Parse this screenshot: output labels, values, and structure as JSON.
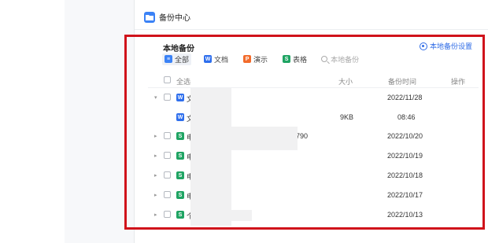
{
  "window": {
    "title": "备份中心"
  },
  "panel": {
    "title": "本地备份",
    "settings_label": "本地备份设置",
    "filters": [
      {
        "label": "全部",
        "icon": "list-icon",
        "active": true
      },
      {
        "label": "文档",
        "icon": "doc-icon",
        "glyph": "W"
      },
      {
        "label": "演示",
        "icon": "ppt-icon",
        "glyph": "P"
      },
      {
        "label": "表格",
        "icon": "xls-icon",
        "glyph": "S"
      }
    ],
    "search_placeholder": "本地备份"
  },
  "table": {
    "headers": {
      "select_all": "全选",
      "size": "大小",
      "time": "备份时间",
      "ops": "操作"
    },
    "rows": [
      {
        "expand": "▾",
        "initial": "文",
        "size": "",
        "date": "2022/11/28",
        "suffix": ""
      },
      {
        "expand": "",
        "initial": "文",
        "size": "9KB",
        "date": "08:46",
        "suffix": ""
      },
      {
        "expand": "▸",
        "initial": "电",
        "size": "",
        "date": "2022/10/20",
        "suffix": "790"
      },
      {
        "expand": "▸",
        "initial": "电",
        "size": "",
        "date": "2022/10/19",
        "suffix": ""
      },
      {
        "expand": "▸",
        "initial": "电",
        "size": "",
        "date": "2022/10/18",
        "suffix": ""
      },
      {
        "expand": "▸",
        "initial": "电",
        "size": "",
        "date": "2022/10/17",
        "suffix": ""
      },
      {
        "expand": "▸",
        "initial": "个",
        "size": "",
        "date": "2022/10/13",
        "suffix": ""
      }
    ]
  },
  "colors": {
    "accent": "#2e6be6",
    "highlight": "#d0131b",
    "doc": "#2f6fed",
    "xls": "#1fa463",
    "ppt": "#f26b2b"
  }
}
